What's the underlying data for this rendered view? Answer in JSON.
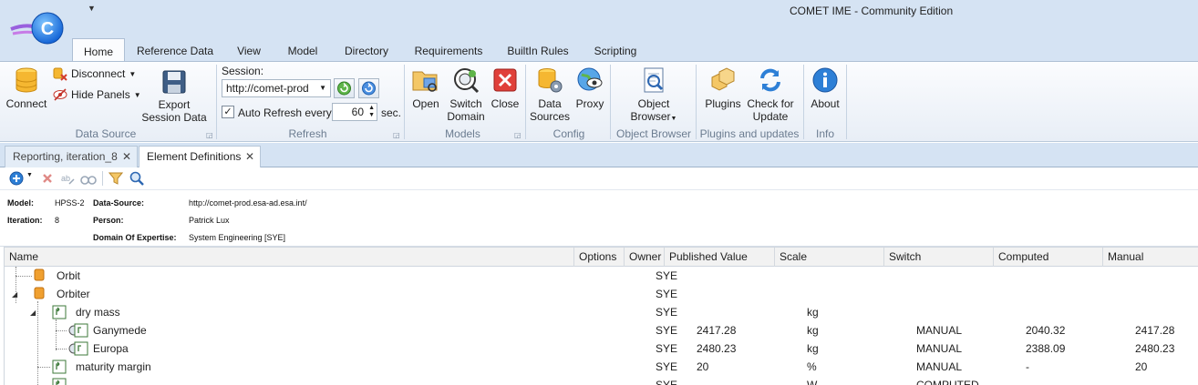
{
  "window": {
    "title": "COMET IME - Community Edition",
    "logo_letter": "C"
  },
  "ribbon_tabs": [
    "Home",
    "Reference Data",
    "View",
    "Model",
    "Directory",
    "Requirements",
    "BuiltIn Rules",
    "Scripting"
  ],
  "ribbon": {
    "data_source": {
      "connect": "Connect",
      "disconnect": "Disconnect",
      "hide_panels": "Hide Panels",
      "export_line1": "Export",
      "export_line2": "Session Data",
      "group_label": "Data Source"
    },
    "refresh": {
      "session_label": "Session:",
      "session_value": "http://comet-prod",
      "auto_refresh_label": "Auto Refresh every",
      "auto_refresh_checked": "✓",
      "interval": "60",
      "unit": "sec.",
      "group_label": "Refresh"
    },
    "models": {
      "open": "Open",
      "switch_line1": "Switch",
      "switch_line2": "Domain",
      "close": "Close",
      "group_label": "Models"
    },
    "config": {
      "data_line1": "Data",
      "data_line2": "Sources",
      "proxy": "Proxy",
      "group_label": "Config"
    },
    "object_browser": {
      "line1": "Object",
      "line2": "Browser",
      "group_label": "Object Browser"
    },
    "plugins": {
      "plugins": "Plugins",
      "check_line1": "Check for",
      "check_line2": "Update",
      "group_label": "Plugins and updates"
    },
    "info": {
      "about": "About",
      "group_label": "Info"
    }
  },
  "doc_tabs": [
    {
      "label": "Reporting, iteration_8"
    },
    {
      "label": "Element Definitions"
    }
  ],
  "info_panel": {
    "model_label": "Model:",
    "model_value": "HPSS-2",
    "iteration_label": "Iteration:",
    "iteration_value": "8",
    "data_source_label": "Data-Source:",
    "data_source_value": "http://comet-prod.esa-ad.esa.int/",
    "person_label": "Person:",
    "person_value": "Patrick Lux",
    "domain_label": "Domain Of Expertise:",
    "domain_value": "System Engineering [SYE]"
  },
  "grid": {
    "columns": [
      "Name",
      "Options",
      "Owner",
      "Published Value",
      "Scale",
      "Switch",
      "Computed",
      "Manual"
    ],
    "rows": [
      {
        "name": "Orbit",
        "owner": "SYE",
        "published": "",
        "scale": "",
        "switch": "",
        "computed": "",
        "manual": "",
        "kind": "element"
      },
      {
        "name": "Orbiter",
        "owner": "SYE",
        "published": "",
        "scale": "",
        "switch": "",
        "computed": "",
        "manual": "",
        "kind": "element"
      },
      {
        "name": "dry mass",
        "owner": "SYE",
        "published": "",
        "scale": "kg",
        "switch": "",
        "computed": "",
        "manual": "",
        "kind": "parameter"
      },
      {
        "name": "Ganymede",
        "owner": "SYE",
        "published": "2417.28",
        "scale": "kg",
        "switch": "MANUAL",
        "computed": "2040.32",
        "manual": "2417.28",
        "kind": "option"
      },
      {
        "name": "Europa",
        "owner": "SYE",
        "published": "2480.23",
        "scale": "kg",
        "switch": "MANUAL",
        "computed": "2388.09",
        "manual": "2480.23",
        "kind": "option"
      },
      {
        "name": "maturity margin",
        "owner": "SYE",
        "published": "20",
        "scale": "%",
        "switch": "MANUAL",
        "computed": "-",
        "manual": "20",
        "kind": "parameter"
      },
      {
        "name": "",
        "owner": "SYE",
        "published": "",
        "scale": "W",
        "switch": "COMPUTED",
        "computed": "",
        "manual": "",
        "kind": "parameter"
      }
    ]
  },
  "colors": {
    "title_bar": "#d5e3f3",
    "accent": "#1b6ac9",
    "element_icon": "#f0a030"
  }
}
